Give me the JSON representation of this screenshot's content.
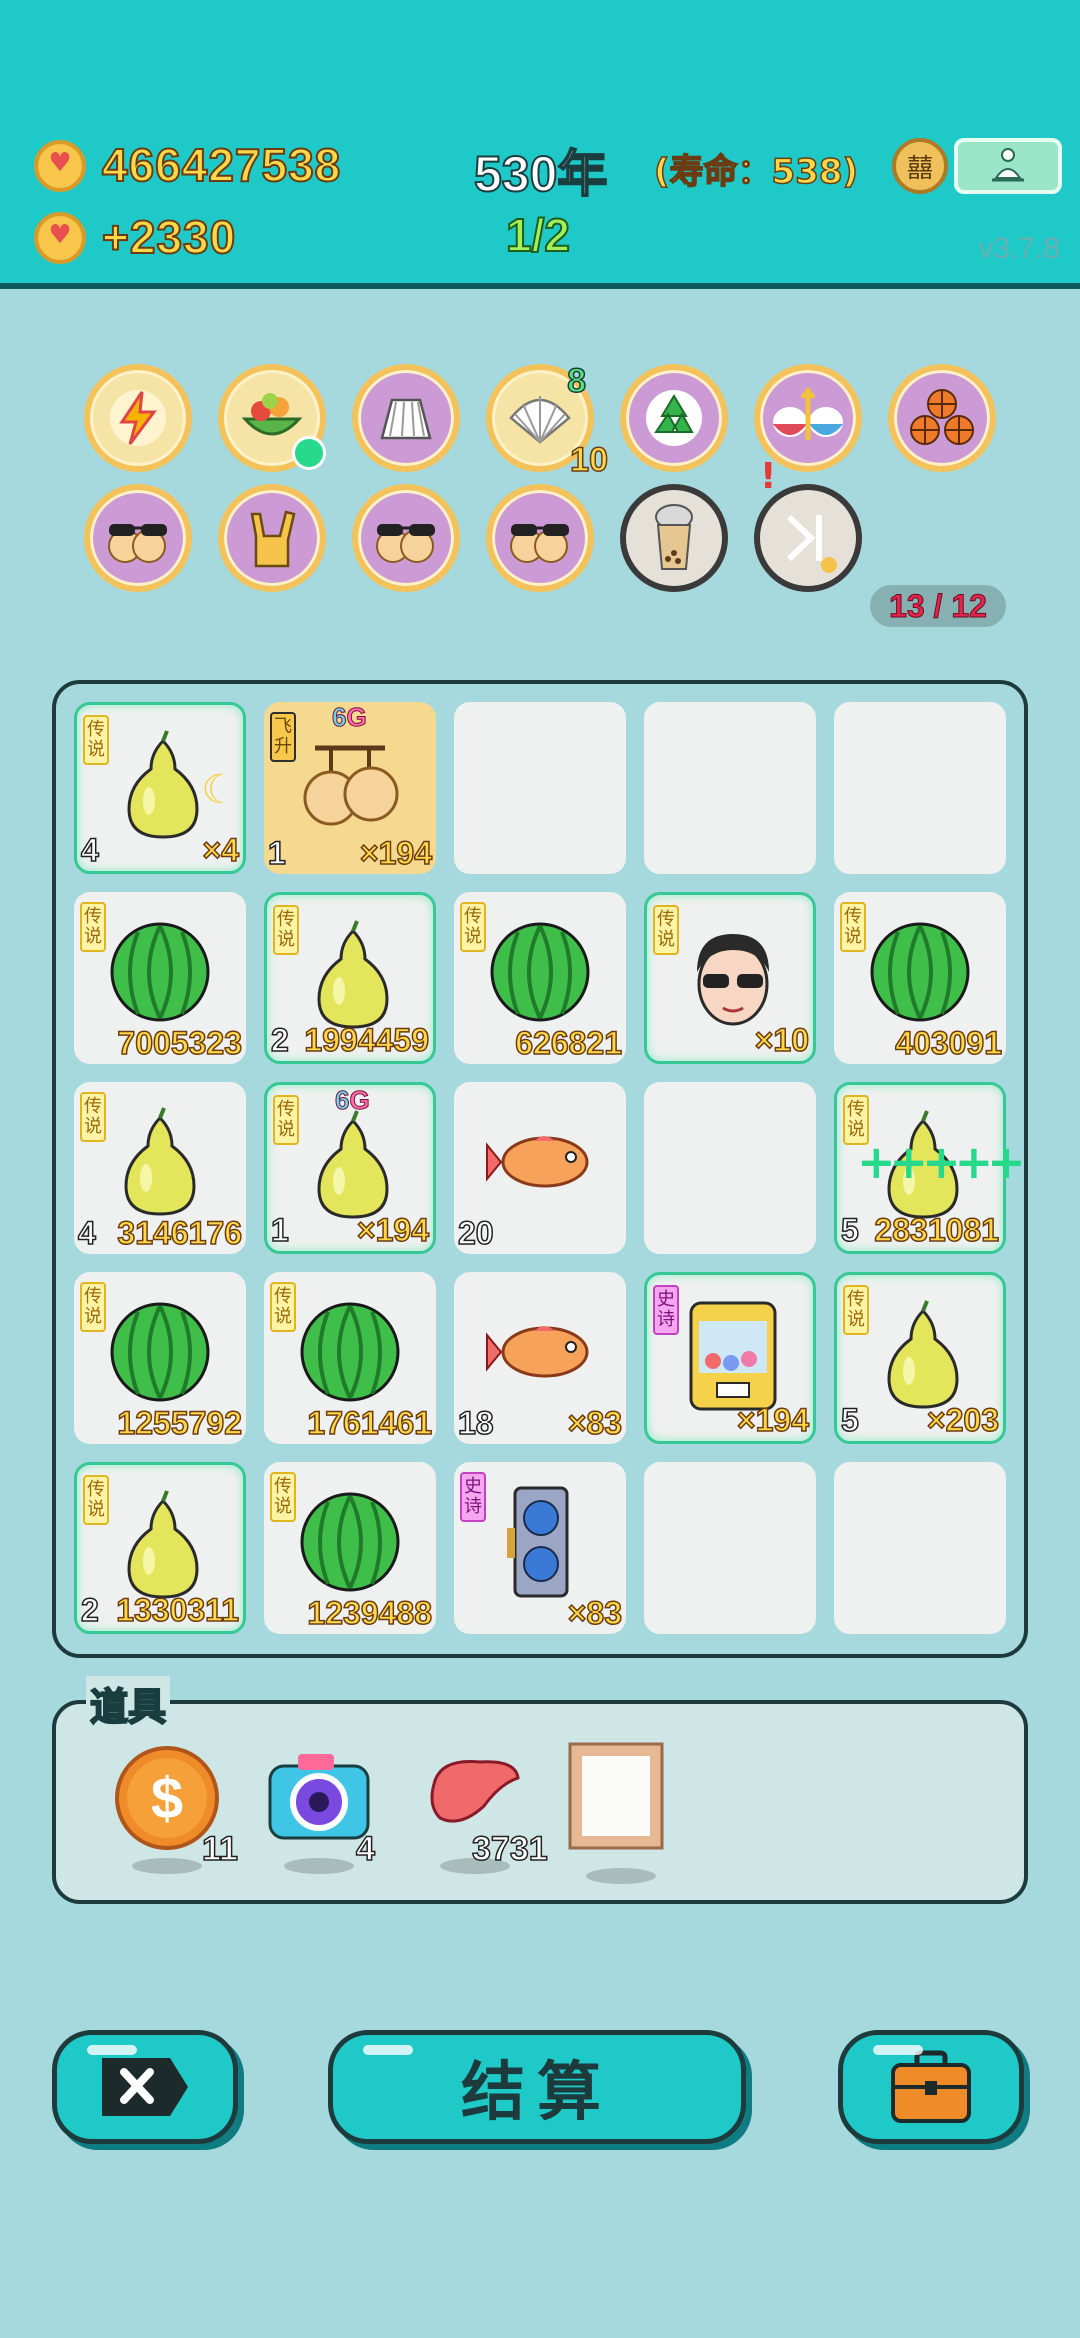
{
  "header": {
    "coins": "466427538",
    "coin_rate": "+2330",
    "year": "530年",
    "lifespan": "(寿命：538)",
    "progress": "1/2",
    "version": "v3.7.8",
    "avatar_glyph": "囍"
  },
  "skills": {
    "row1": [
      {
        "icon": "lightning-icon",
        "style": "cream"
      },
      {
        "icon": "fruit-basket-icon",
        "style": "cream"
      },
      {
        "icon": "skirt-icon",
        "style": "purple"
      },
      {
        "icon": "shell-icon",
        "style": "cream",
        "badge_top": "8",
        "badge_bottom": "10"
      },
      {
        "icon": "recycle-icon",
        "style": "purple"
      },
      {
        "icon": "ramen-bowls-icon",
        "style": "purple"
      },
      {
        "icon": "basketballs-icon",
        "style": "purple"
      }
    ],
    "row2": [
      {
        "icon": "sunglasses-peach-icon",
        "style": "purple"
      },
      {
        "icon": "rock-hand-icon",
        "style": "purple"
      },
      {
        "icon": "sunglasses-peach-icon",
        "style": "purple"
      },
      {
        "icon": "sunglasses-peach-icon",
        "style": "purple"
      },
      {
        "icon": "bubble-tea-icon",
        "style": "grey"
      },
      {
        "icon": "skip-icon",
        "style": "grey"
      }
    ],
    "count": "13 / 12"
  },
  "board": {
    "cells": [
      {
        "row": 0,
        "col": 0,
        "item": "pear",
        "tag": "传说",
        "tag_type": "leg",
        "glow": true,
        "lvl": "4",
        "num": "×4",
        "extra": "moon"
      },
      {
        "row": 0,
        "col": 1,
        "item": "peaches",
        "tag": "飞升",
        "tag_type": "fly",
        "gold": true,
        "g": "6G",
        "lvl": "1",
        "num": "×194"
      },
      {
        "row": 0,
        "col": 2,
        "item": "empty"
      },
      {
        "row": 0,
        "col": 3,
        "item": "empty"
      },
      {
        "row": 0,
        "col": 4,
        "item": "empty"
      },
      {
        "row": 1,
        "col": 0,
        "item": "watermelon",
        "tag": "传说",
        "tag_type": "leg",
        "num": "7005323"
      },
      {
        "row": 1,
        "col": 1,
        "item": "pear",
        "tag": "传说",
        "tag_type": "leg",
        "glow": true,
        "lvl": "2",
        "num": "1994459"
      },
      {
        "row": 1,
        "col": 2,
        "item": "watermelon",
        "tag": "传说",
        "tag_type": "leg",
        "num": "626821"
      },
      {
        "row": 1,
        "col": 3,
        "item": "man",
        "tag": "传说",
        "tag_type": "leg",
        "glow": true,
        "num": "×10"
      },
      {
        "row": 1,
        "col": 4,
        "item": "watermelon",
        "tag": "传说",
        "tag_type": "leg",
        "num": "403091"
      },
      {
        "row": 2,
        "col": 0,
        "item": "pear",
        "tag": "传说",
        "tag_type": "leg",
        "lvl": "4",
        "num": "3146176"
      },
      {
        "row": 2,
        "col": 1,
        "item": "pear",
        "tag": "传说",
        "tag_type": "leg",
        "glow": true,
        "g": "6G",
        "lvl": "1",
        "num": "×194"
      },
      {
        "row": 2,
        "col": 2,
        "item": "fish",
        "lvl": "20"
      },
      {
        "row": 2,
        "col": 3,
        "item": "empty"
      },
      {
        "row": 2,
        "col": 4,
        "item": "pear",
        "tag": "传说",
        "tag_type": "leg",
        "glow": true,
        "extra": "sparkle",
        "lvl": "5",
        "num": "2831081"
      },
      {
        "row": 3,
        "col": 0,
        "item": "watermelon",
        "tag": "传说",
        "tag_type": "leg",
        "num": "1255792"
      },
      {
        "row": 3,
        "col": 1,
        "item": "watermelon",
        "tag": "传说",
        "tag_type": "leg",
        "num": "1761461"
      },
      {
        "row": 3,
        "col": 2,
        "item": "fish",
        "lvl": "18",
        "num": "×83"
      },
      {
        "row": 3,
        "col": 3,
        "item": "claw-machine",
        "tag": "史诗",
        "tag_type": "epic",
        "glow": true,
        "num": "×194"
      },
      {
        "row": 3,
        "col": 4,
        "item": "pear",
        "tag": "传说",
        "tag_type": "leg",
        "glow": true,
        "lvl": "5",
        "num": "×203"
      },
      {
        "row": 4,
        "col": 0,
        "item": "pear",
        "tag": "传说",
        "tag_type": "leg",
        "glow": true,
        "lvl": "2",
        "num": "1330311"
      },
      {
        "row": 4,
        "col": 1,
        "item": "watermelon",
        "tag": "传说",
        "tag_type": "leg",
        "num": "1239488"
      },
      {
        "row": 4,
        "col": 2,
        "item": "graphics-card",
        "tag": "史诗",
        "tag_type": "epic",
        "num": "×83"
      },
      {
        "row": 4,
        "col": 3,
        "item": "empty"
      },
      {
        "row": 4,
        "col": 4,
        "item": "empty"
      }
    ]
  },
  "tools": {
    "label": "道具",
    "items": [
      {
        "name": "coin-tool",
        "count": "11"
      },
      {
        "name": "camera-tool",
        "count": "4"
      },
      {
        "name": "liver-tool",
        "count": "3731"
      },
      {
        "name": "frame-tool",
        "count": ""
      }
    ]
  },
  "footer": {
    "settle_label": "结算"
  },
  "colors": {
    "background": "#a6d9dd",
    "header": "#1ec9c7",
    "gold_text": "#ffd84a",
    "glow_border": "#36c896"
  }
}
